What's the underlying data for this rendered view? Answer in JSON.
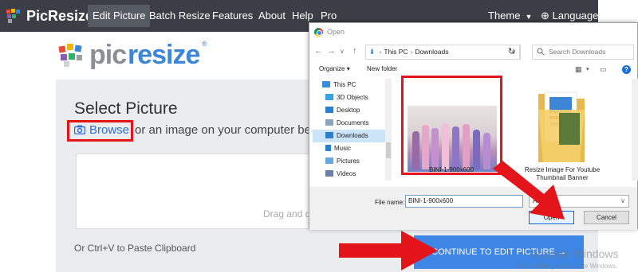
{
  "navbar": {
    "brand": "PicResize",
    "items": [
      {
        "label": "Edit Picture",
        "active": true
      },
      {
        "label": "Batch Resize"
      },
      {
        "label": "Features"
      },
      {
        "label": "About"
      },
      {
        "label": "Help"
      },
      {
        "label": "Pro"
      }
    ],
    "theme_label": "Theme",
    "language_label": "Language:"
  },
  "page_logo": {
    "part1": "pic",
    "part2": "resize",
    "reg": "®"
  },
  "main": {
    "title": "Select Picture",
    "browse_label": "Browse",
    "browse_rest": "or an image on your computer bel",
    "drag_text": "Drag and d",
    "paste_text": "Or Ctrl+V to Paste Clipboard",
    "continue_label": "CONTINUE TO EDIT PICTURE →"
  },
  "watermark": {
    "title": "Activate Windows",
    "subtitle": "Go to Settings to activate Windows."
  },
  "dialog": {
    "title": "Open",
    "path": [
      "This PC",
      "Downloads"
    ],
    "search_placeholder": "Search Downloads",
    "organize_label": "Organize",
    "new_folder_label": "New folder",
    "nav_items": [
      {
        "label": "This PC",
        "icon": "computer-icon",
        "color": "#3b8ed8"
      },
      {
        "label": "3D Objects",
        "icon": "cube-icon",
        "color": "#35a3e6"
      },
      {
        "label": "Desktop",
        "icon": "desktop-icon",
        "color": "#2b7fd3"
      },
      {
        "label": "Documents",
        "icon": "documents-icon",
        "color": "#8aa5c4"
      },
      {
        "label": "Downloads",
        "icon": "download-icon",
        "color": "#2b7fd3",
        "selected": true
      },
      {
        "label": "Music",
        "icon": "music-icon",
        "color": "#2b7fd3"
      },
      {
        "label": "Pictures",
        "icon": "pictures-icon",
        "color": "#6aa7dd"
      },
      {
        "label": "Videos",
        "icon": "videos-icon",
        "color": "#6a7fa9"
      }
    ],
    "files": [
      {
        "name": "BINI-1-900x600",
        "type": "image",
        "selected": true
      },
      {
        "name": "Resize Image For Youtube Thumbnail Banner",
        "type": "folder"
      }
    ],
    "filename_label": "File name:",
    "filename_value": "BINI-1-900x600",
    "filetype_value": "All Files",
    "open_label": "Open",
    "cancel_label": "Cancel"
  },
  "colors": {
    "accent_blue": "#3d86e6",
    "highlight_red": "#e4141b",
    "navbar_bg": "#3b3f45"
  }
}
